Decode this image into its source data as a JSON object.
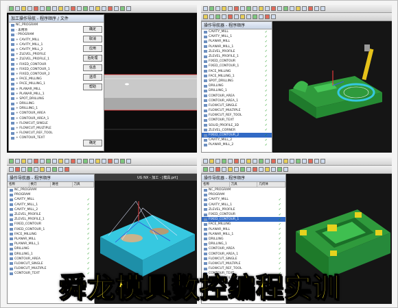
{
  "caption": "舜龙模具数控编程实训",
  "panels": {
    "q1": {
      "dialog_title": "加工操作导航 - 程序顺序 / 文件",
      "buttons": [
        "确定",
        "取消",
        "应用",
        "后处理",
        "信息",
        "选项",
        "帮助"
      ],
      "tree_rows": [
        "NC_PROGRAM",
        "- 未用项",
        "- PROGRAM",
        "  + CAVITY_MILL",
        "  + CAVITY_MILL_1",
        "  + CAVITY_MILL_2",
        "  + ZLEVEL_PROFILE",
        "  + ZLEVEL_PROFILE_1",
        "  + FIXED_CONTOUR",
        "  + FIXED_CONTOUR_1",
        "  + FIXED_CONTOUR_2",
        "  + FACE_MILLING",
        "  + FACE_MILLING_1",
        "  + PLANAR_MILL",
        "  + PLANAR_MILL_1",
        "  + SPOT_DRILLING",
        "  + DRILLING",
        "  + DRILLING_1",
        "  + CONTOUR_AREA",
        "  + CONTOUR_AREA_1",
        "  + FLOWCUT_SINGLE",
        "  + FLOWCUT_MULTIPLE",
        "  + FLOWCUT_REF_TOOL",
        "  + CONTOUR_TEXT"
      ],
      "bottom_button": "确定"
    },
    "q2": {
      "panel_title": "操作导航器 - 程序顺序",
      "rows": [
        "CAVITY_MILL",
        "CAVITY_MILL_1",
        "PLANAR_MILL",
        "PLANAR_MILL_1",
        "ZLEVEL_PROFILE",
        "ZLEVEL_PROFILE_1",
        "FIXED_CONTOUR",
        "FIXED_CONTOUR_1",
        "FACE_MILLING",
        "FACE_MILLING_1",
        "SPOT_DRILLING",
        "DRILLING",
        "DRILLING_1",
        "CONTOUR_AREA",
        "CONTOUR_AREA_1",
        "FLOWCUT_SINGLE",
        "FLOWCUT_MULTIPLE",
        "FLOWCUT_REF_TOOL",
        "CONTOUR_TEXT",
        "SOLID_PROFILE_3D",
        "ZLEVEL_CORNER",
        "FIXED_CONTOUR_2",
        "CAVITY_MILL_2",
        "PLANAR_MILL_2"
      ],
      "selected_row": 21
    },
    "q3": {
      "panel_title": "操作导航器 - 程序顺序",
      "columns": [
        "名称",
        "换刀",
        "路径",
        "刀具"
      ],
      "rows": [
        "NC_PROGRAM",
        "PROGRAM",
        "CAVITY_MILL",
        "CAVITY_MILL_1",
        "CAVITY_MILL_2",
        "ZLEVEL_PROFILE",
        "ZLEVEL_PROFILE_1",
        "FIXED_CONTOUR",
        "FIXED_CONTOUR_1",
        "FACE_MILLING",
        "PLANAR_MILL",
        "PLANAR_MILL_1",
        "DRILLING",
        "DRILLING_1",
        "CONTOUR_AREA",
        "FLOWCUT_SINGLE",
        "FLOWCUT_MULTIPLE",
        "CONTOUR_TEXT"
      ],
      "viewport_title": "UG NX - 加工 - [模具.prt]"
    },
    "q4": {
      "panel_title": "操作导航器 - 程序顺序",
      "columns": [
        "名称",
        "刀具",
        "几何体"
      ],
      "rows": [
        "NC_PROGRAM",
        "PROGRAM",
        "CAVITY_MILL",
        "CAVITY_MILL_1",
        "ZLEVEL_PROFILE",
        "FIXED_CONTOUR",
        "FIXED_CONTOUR_1",
        "FACE_MILLING",
        "PLANAR_MILL",
        "PLANAR_MILL_1",
        "DRILLING",
        "DRILLING_1",
        "CONTOUR_AREA",
        "CONTOUR_AREA_1",
        "FLOWCUT_SINGLE",
        "FLOWCUT_MULTIPLE",
        "FLOWCUT_REF_TOOL",
        "CONTOUR_TEXT",
        "SOLID_PROFILE_3D",
        "ZLEVEL_CORNER"
      ],
      "selected_row": 6
    }
  },
  "colors": {
    "caption": "#ffe82a",
    "selection": "#316ac5",
    "part_green": "#2f9a3c",
    "part_cyan": "#36c8e0",
    "viewport_dark": "#141414"
  }
}
